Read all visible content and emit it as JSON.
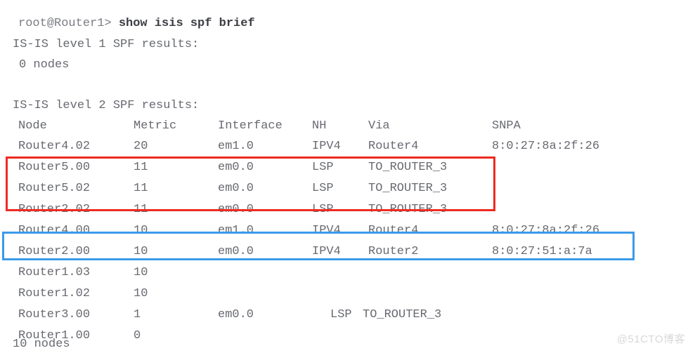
{
  "terminal": {
    "prompt": "root@Router1>",
    "command": "show isis spf brief",
    "level1_header": "IS-IS level 1 SPF results:",
    "level1_nodes": "0 nodes",
    "level2_header": "IS-IS level 2 SPF results:",
    "level2_nodes": "10 nodes"
  },
  "table": {
    "columns": [
      "Node",
      "Metric",
      "Interface",
      "NH",
      "Via",
      "SNPA"
    ],
    "rows": [
      {
        "node": "Router4.02",
        "metric": "20",
        "interface": "em1.0",
        "nh": "IPV4",
        "via": "Router4",
        "snpa": "8:0:27:8a:2f:26"
      },
      {
        "node": "Router5.00",
        "metric": "11",
        "interface": "em0.0",
        "nh": "LSP",
        "via": "TO_ROUTER_3",
        "snpa": ""
      },
      {
        "node": "Router5.02",
        "metric": "11",
        "interface": "em0.0",
        "nh": "LSP",
        "via": "TO_ROUTER_3",
        "snpa": ""
      },
      {
        "node": "Router2.02",
        "metric": "11",
        "interface": "em0.0",
        "nh": "LSP",
        "via": "TO_ROUTER_3",
        "snpa": ""
      },
      {
        "node": "Router4.00",
        "metric": "10",
        "interface": "em1.0",
        "nh": "IPV4",
        "via": "Router4",
        "snpa": "8:0:27:8a:2f:26"
      },
      {
        "node": "Router2.00",
        "metric": "10",
        "interface": "em0.0",
        "nh": "IPV4",
        "via": "Router2",
        "snpa": "8:0:27:51:a:7a"
      },
      {
        "node": "Router1.03",
        "metric": "10",
        "interface": "",
        "nh": "",
        "via": "",
        "snpa": ""
      },
      {
        "node": "Router1.02",
        "metric": "10",
        "interface": "",
        "nh": "",
        "via": "",
        "snpa": ""
      },
      {
        "node": "Router3.00",
        "metric": "1",
        "interface": "em0.0",
        "nh": "LSP",
        "via": "TO_ROUTER_3",
        "snpa": ""
      },
      {
        "node": "Router1.00",
        "metric": "0",
        "interface": "",
        "nh": "",
        "via": "",
        "snpa": ""
      }
    ]
  },
  "annotations": {
    "red_box_color": "#ee2a22",
    "blue_box_color": "#3b9ae8"
  },
  "watermark": {
    "text": "@51CTO博客"
  },
  "colors": {
    "text": "#686a70",
    "command": "#3b3d42",
    "background": "#ffffff"
  }
}
